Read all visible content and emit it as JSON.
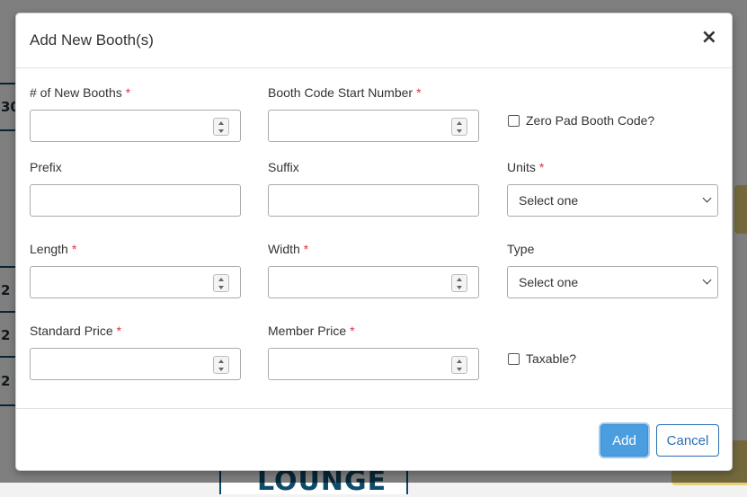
{
  "background": {
    "cell_labels": [
      "30",
      "2",
      "2",
      "2"
    ],
    "lounge_label": "LOUNGE"
  },
  "modal": {
    "title": "Add New Booth(s)",
    "close_glyph": "×",
    "required_marker": "*",
    "fields": {
      "num_booths": {
        "label": "# of New Booths",
        "value": ""
      },
      "start_number": {
        "label": "Booth Code Start Number",
        "value": ""
      },
      "zero_pad": {
        "label": "Zero Pad Booth Code?",
        "checked": false
      },
      "prefix": {
        "label": "Prefix",
        "value": ""
      },
      "suffix": {
        "label": "Suffix",
        "value": ""
      },
      "units": {
        "label": "Units",
        "selected": "Select one"
      },
      "length": {
        "label": "Length",
        "value": ""
      },
      "width": {
        "label": "Width",
        "value": ""
      },
      "type": {
        "label": "Type",
        "selected": "Select one"
      },
      "standard_price": {
        "label": "Standard Price",
        "value": ""
      },
      "member_price": {
        "label": "Member Price",
        "value": ""
      },
      "taxable": {
        "label": "Taxable?",
        "checked": false
      }
    },
    "buttons": {
      "add": "Add",
      "cancel": "Cancel"
    }
  },
  "colors": {
    "primary": "#4a9ee0",
    "required": "#dc3545",
    "cancel_text": "#2a6fb0"
  }
}
